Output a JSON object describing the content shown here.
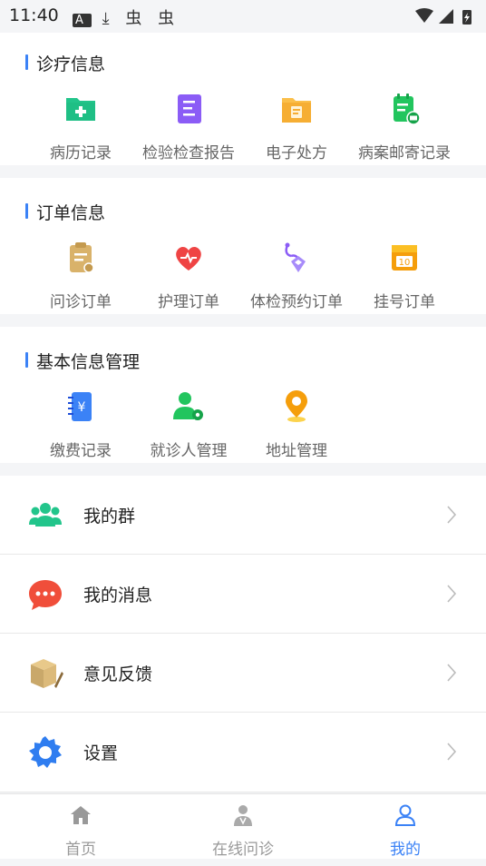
{
  "status": {
    "time": "11:40",
    "icons": [
      "A",
      "⤓",
      "虫",
      "虫"
    ]
  },
  "sections": [
    {
      "title": "诊疗信息",
      "items": [
        {
          "label": "病历记录",
          "icon": "folder-plus-icon"
        },
        {
          "label": "检验检查报告",
          "icon": "report-icon"
        },
        {
          "label": "电子处方",
          "icon": "prescription-folder-icon"
        },
        {
          "label": "病案邮寄记录",
          "icon": "mail-record-icon"
        }
      ]
    },
    {
      "title": "订单信息",
      "items": [
        {
          "label": "问诊订单",
          "icon": "clipboard-icon"
        },
        {
          "label": "护理订单",
          "icon": "heart-icon"
        },
        {
          "label": "体检预约订单",
          "icon": "stethoscope-icon"
        },
        {
          "label": "挂号订单",
          "icon": "calendar-icon"
        }
      ]
    },
    {
      "title": "基本信息管理",
      "items": [
        {
          "label": "缴费记录",
          "icon": "payment-icon"
        },
        {
          "label": "就诊人管理",
          "icon": "user-gear-icon"
        },
        {
          "label": "地址管理",
          "icon": "location-pin-icon"
        }
      ]
    }
  ],
  "menu": [
    {
      "label": "我的群",
      "icon": "group-icon"
    },
    {
      "label": "我的消息",
      "icon": "message-icon"
    },
    {
      "label": "意见反馈",
      "icon": "feedback-box-icon"
    },
    {
      "label": "设置",
      "icon": "settings-gear-icon"
    }
  ],
  "tabs": [
    {
      "label": "首页",
      "icon": "home-icon"
    },
    {
      "label": "在线问诊",
      "icon": "doctor-icon"
    },
    {
      "label": "我的",
      "icon": "profile-icon",
      "active": true
    }
  ],
  "colors": {
    "accent": "#3b82f6",
    "divider": "#f4f5f7"
  }
}
